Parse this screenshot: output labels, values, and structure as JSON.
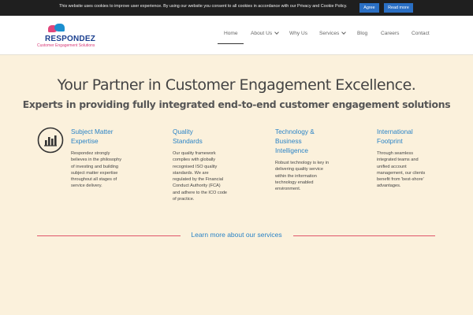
{
  "cookie": {
    "text": "This website uses cookies to improve user experience. By using our website you consent to all cookies in accordance with our Privacy and Cookie Policy.",
    "agree_label": "Agree",
    "read_more_label": "Read more"
  },
  "logo": {
    "name": "RESPONDEZ",
    "tagline": "Customer Engagement Solutions"
  },
  "nav": {
    "items": [
      {
        "label": "Home",
        "active": true
      },
      {
        "label": "About Us",
        "dropdown": true
      },
      {
        "label": "Why Us"
      },
      {
        "label": "Services",
        "dropdown": true
      },
      {
        "label": "Blog"
      },
      {
        "label": "Careers"
      },
      {
        "label": "Contact"
      }
    ]
  },
  "hero": {
    "title": "Your Partner in Customer Engagement Excellence.",
    "subtitle": "Experts in providing fully integrated end-to-end customer engagement solutions"
  },
  "features": [
    {
      "icon": "bar-chart-icon",
      "title": [
        "Subject Matter",
        "Expertise"
      ],
      "desc": [
        "Respondez strongly",
        "believes in the philosophy",
        "of investing and building",
        "subject matter expertise",
        "throughout all stages of",
        "service delivery."
      ]
    },
    {
      "title": [
        "Quality",
        "Standards"
      ],
      "desc": [
        "Our quality framework",
        "complies with globally",
        "recognised ISO quality",
        "standards. We are",
        "regulated by the Financial",
        "Conduct Authority (FCA)",
        "and adhere to the ICO code",
        "of practice."
      ]
    },
    {
      "title": [
        "Technology &",
        "Business",
        "Intelligence"
      ],
      "desc": [
        "Robust technology is key in",
        "delivering quality service",
        "within the information",
        "technology enabled",
        "environment."
      ]
    },
    {
      "title": [
        "International",
        "Footprint"
      ],
      "desc": [
        "Through seamless",
        "integrated teams and",
        "unified account",
        "management, our clients",
        "benefit from 'best-shore'",
        "advantages."
      ]
    }
  ],
  "learn_more_label": "Learn more about our services",
  "colors": {
    "accent_blue": "#2a83c6",
    "divider_pink": "#e0556a",
    "background": "#fbf1dc"
  }
}
